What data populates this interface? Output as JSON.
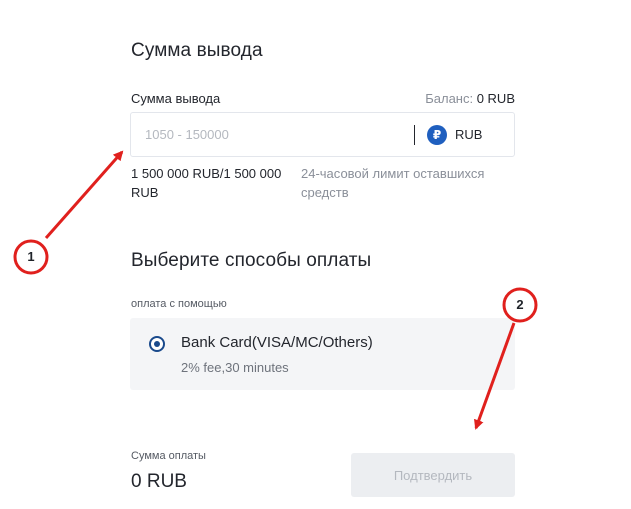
{
  "withdraw": {
    "title": "Сумма вывода",
    "field_label": "Сумма вывода",
    "balance_label": "Баланс: ",
    "balance_value": "0 RUB",
    "amount_placeholder": "1050 - 150000",
    "currency_icon": "₽",
    "currency": "RUB",
    "limit_value": "1 500 000 RUB/1 500 000 RUB",
    "limit_description": "24-часовой лимит оставшихся средств"
  },
  "payment": {
    "title": "Выберите способы оплаты",
    "pay_with_label": "оплата с помощью",
    "method_name": "Bank Card(VISA/MC/Others)",
    "method_fee": "2% fee,30 minutes"
  },
  "footer": {
    "total_label": "Сумма оплаты",
    "total_value": "0 RUB",
    "confirm_label": "Подтвердить"
  },
  "annotations": {
    "marker_1": "1",
    "marker_2": "2",
    "color": "#e0201d"
  },
  "colors": {
    "accent": "#1a4a8c",
    "currency_icon_bg": "#1f5fbf",
    "disabled_button_bg": "#eceef1"
  }
}
